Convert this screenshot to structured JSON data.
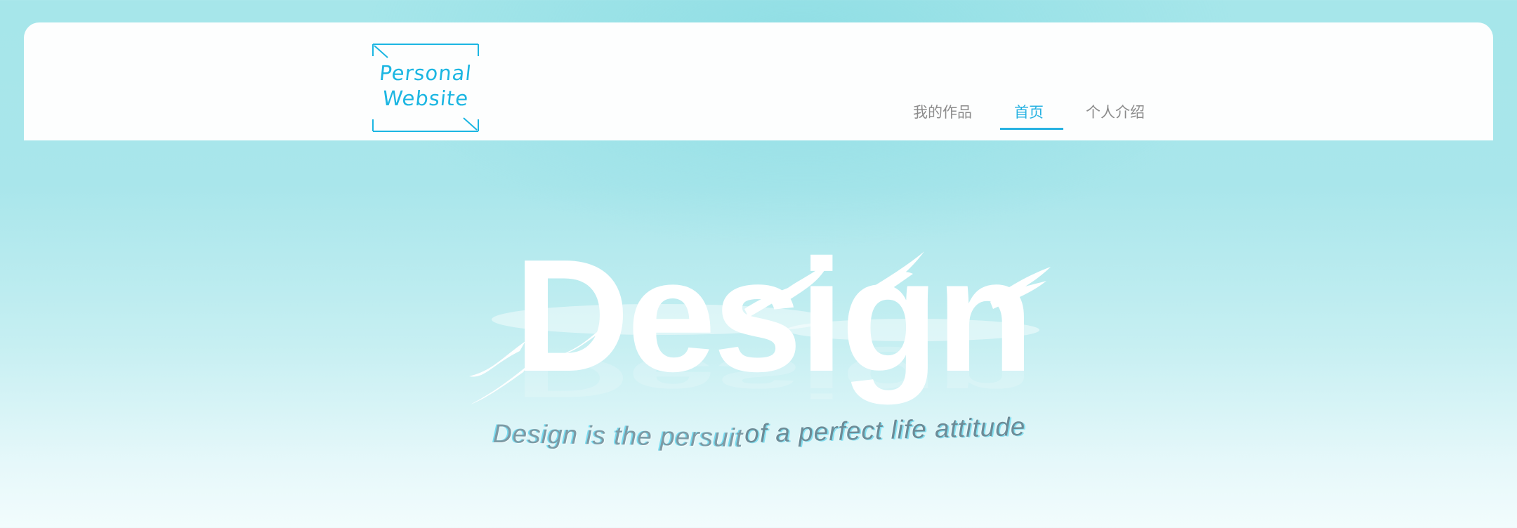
{
  "header": {
    "logo": {
      "line1": "Personal",
      "line2": "Website",
      "color": "#1cb6e2"
    },
    "nav": [
      {
        "label": "我的作品",
        "active": false
      },
      {
        "label": "首页",
        "active": true
      },
      {
        "label": "个人介绍",
        "active": false
      }
    ],
    "active_color": "#27b2e2"
  },
  "hero": {
    "title": "Design",
    "subtitle_part1": "Design is the persuit",
    "subtitle_part2": "of a perfect life attitude",
    "background_top": "#a6e6ea",
    "background_bottom": "#f2fcfd"
  }
}
